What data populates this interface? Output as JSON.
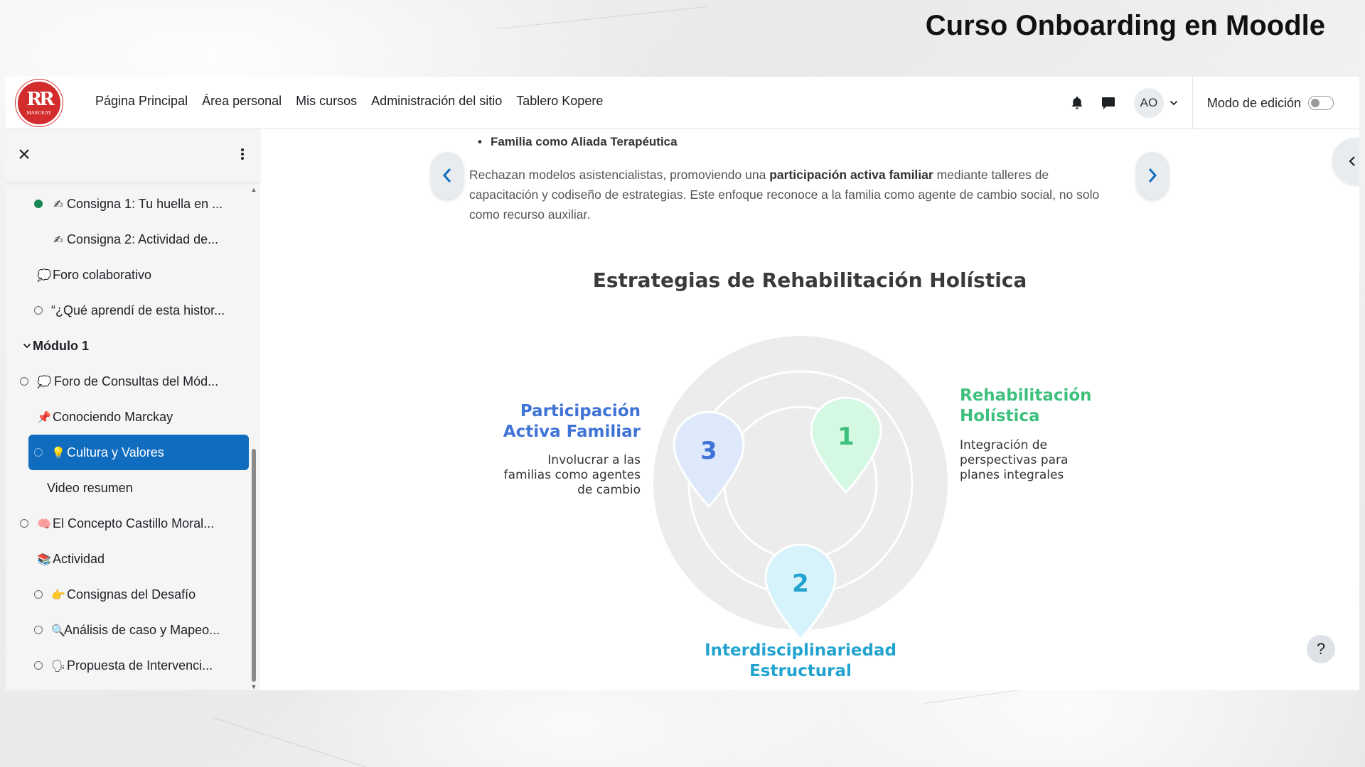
{
  "slide": {
    "title": "Curso Onboarding en Moodle"
  },
  "brand": {
    "logo_text": "MARCKAY",
    "logo_mark": "RR",
    "accent": "#d32c2c"
  },
  "navbar": {
    "links": [
      "Página Principal",
      "Área personal",
      "Mis cursos",
      "Administración del sitio",
      "Tablero Kopere"
    ],
    "user_initials": "AO",
    "edit_mode_label": "Modo de edición",
    "edit_mode_on": false
  },
  "sidebar": {
    "items": [
      {
        "label": "Consigna 1: Tu huella en ...",
        "emoji": "✍",
        "marker": "filled"
      },
      {
        "label": "Consigna 2: Actividad de...",
        "emoji": "✍",
        "marker": "none"
      },
      {
        "label": "Foro colaborativo",
        "emoji": "💭",
        "marker": "none"
      },
      {
        "label": "“¿Qué aprendí de esta histor...",
        "emoji": "",
        "marker": "open"
      },
      {
        "label": "Módulo 1",
        "emoji": "",
        "marker": "chevron"
      },
      {
        "label": "Foro de Consultas del Mód...",
        "emoji": "💭",
        "marker": "open"
      },
      {
        "label": "Conociendo Marckay",
        "emoji": "📌",
        "marker": "none"
      },
      {
        "label": "Cultura y Valores",
        "emoji": "💡",
        "marker": "open"
      },
      {
        "label": "Video resumen",
        "emoji": "",
        "marker": "none"
      },
      {
        "label": "El Concepto Castillo Moral...",
        "emoji": "🧠",
        "marker": "open"
      },
      {
        "label": "Actividad",
        "emoji": "📚",
        "marker": "none"
      },
      {
        "label": "Consignas del Desafío",
        "emoji": "👉",
        "marker": "open"
      },
      {
        "label": "Análisis de caso y Mapeo...",
        "emoji": "🔍",
        "marker": "open"
      },
      {
        "label": "Propuesta de Intervenci...",
        "emoji": "🗣",
        "marker": "open"
      }
    ],
    "active_color": "#0f6cbf"
  },
  "content": {
    "bullet": "Familia como Aliada Terapéutica",
    "para_1": "Rechazan modelos asistencialistas, promoviendo una ",
    "para_bold": "participación activa familiar",
    "para_2": " mediante talleres de capacitación y codiseño de estrategias. Este enfoque reconoce a la familia como agente de cambio social, no solo como recurso auxiliar.",
    "infographic": {
      "title": "Estrategias de Rehabilitación Holística",
      "pins": [
        {
          "number": "1",
          "color": "#d4f8e2",
          "text_color": "#3ec07d"
        },
        {
          "number": "2",
          "color": "#d6f2fb",
          "text_color": "#23a3cf"
        },
        {
          "number": "3",
          "color": "#dde8fb",
          "text_color": "#3f73d6"
        }
      ],
      "labels": {
        "right_title_1": "Rehabilitación",
        "right_title_2": "Holística",
        "right_desc_1": "Integración de",
        "right_desc_2": "perspectivas para",
        "right_desc_3": "planes integrales",
        "left_title_1": "Participación",
        "left_title_2": "Activa Familiar",
        "left_desc_1": "Involucrar a las",
        "left_desc_2": "familias como agentes",
        "left_desc_3": "de cambio",
        "bottom_title_1": "Interdisciplinariedad",
        "bottom_title_2": "Estructural"
      },
      "colors": {
        "green": "#3ec07d",
        "blue": "#3f73d6",
        "cyan": "#23a3cf",
        "circle": "#ececec"
      }
    }
  },
  "help_label": "?"
}
